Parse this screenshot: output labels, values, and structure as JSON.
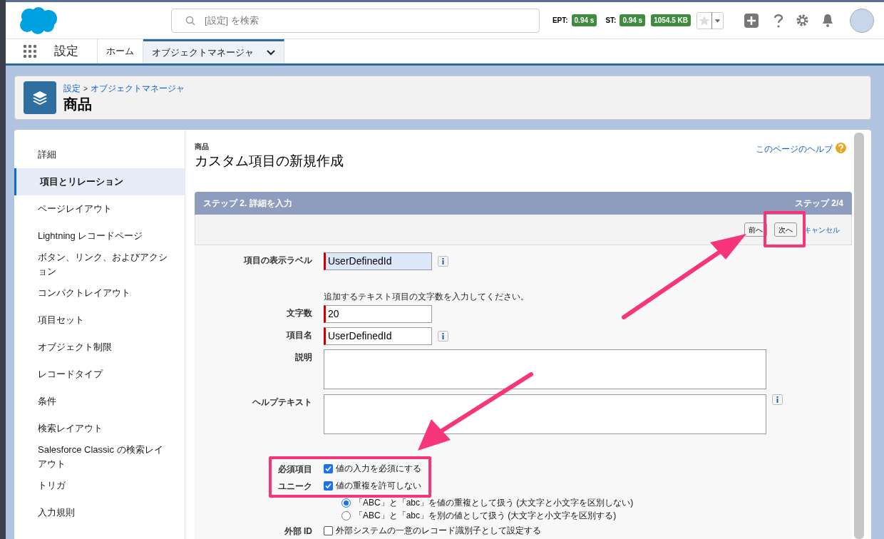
{
  "header": {
    "search": {
      "placeholder": "[設定] を検索"
    },
    "metrics": [
      {
        "label": "EPT:",
        "value": "0.94 s"
      },
      {
        "label": "ST:",
        "value": "0.94 s"
      },
      {
        "value": "1054.5 KB"
      }
    ]
  },
  "nav": {
    "app_name": "設定",
    "tabs": [
      {
        "label": "ホーム",
        "selected": false
      },
      {
        "label": "オブジェクトマネージャ",
        "selected": true
      }
    ]
  },
  "page_header": {
    "breadcrumb": [
      "設定",
      "オブジェクトマネージャ"
    ],
    "breadcrumb_separator": ">",
    "title": "商品"
  },
  "sidebar": {
    "items": [
      {
        "label": "詳細",
        "selected": false
      },
      {
        "label": "項目とリレーション",
        "selected": true
      },
      {
        "label": "ページレイアウト",
        "selected": false
      },
      {
        "label": "Lightning レコードページ",
        "selected": false
      },
      {
        "label": "ボタン、リンク、およびアクション",
        "selected": false
      },
      {
        "label": "コンパクトレイアウト",
        "selected": false
      },
      {
        "label": "項目セット",
        "selected": false
      },
      {
        "label": "オブジェクト制限",
        "selected": false
      },
      {
        "label": "レコードタイプ",
        "selected": false
      },
      {
        "label": "条件",
        "selected": false
      },
      {
        "label": "検索レイアウト",
        "selected": false
      },
      {
        "label": "Salesforce Classic の検索レイアウト",
        "selected": false
      },
      {
        "label": "トリガ",
        "selected": false
      },
      {
        "label": "入力規則",
        "selected": false
      }
    ]
  },
  "content": {
    "object": "商品",
    "title": "カスタム項目の新規作成",
    "help_link": "このページのヘルプ",
    "step": {
      "title": "ステップ 2. 詳細を入力",
      "counter": "ステップ 2/4"
    },
    "buttons": [
      "前へ",
      "次へ"
    ],
    "cancel_link": "キャンセル",
    "fields": [
      {
        "kind": "text",
        "label": "項目の表示ラベル",
        "value": "UserDefinedId",
        "required": true,
        "info": true,
        "focused": true
      },
      {
        "kind": "note",
        "text": "追加するテキスト項目の文字数を入力してください。"
      },
      {
        "kind": "text",
        "label": "文字数",
        "value": "20",
        "required": true,
        "info": false,
        "focused": false
      },
      {
        "kind": "text",
        "label": "項目名",
        "value": "UserDefinedId",
        "required": true,
        "info": true,
        "focused": false
      },
      {
        "kind": "textarea",
        "label": "説明",
        "info": false
      },
      {
        "kind": "textarea",
        "label": "ヘルプテキスト",
        "info": true
      },
      {
        "kind": "checkbox",
        "label": "必須項目",
        "text": "値の入力を必須にする",
        "checked": true
      },
      {
        "kind": "checkbox",
        "label": "ユニーク",
        "text": "値の重複を許可しない",
        "checked": true
      },
      {
        "kind": "radio",
        "text": "「ABC」と「abc」を値の重複として扱う (大文字と小文字を区別しない)",
        "selected": true
      },
      {
        "kind": "radio",
        "text": "「ABC」と「abc」を別の値として扱う (大文字と小文字を区別する)",
        "selected": false
      },
      {
        "kind": "checkbox",
        "label": "外部 ID",
        "text": "外部システムの一意のレコード識別子として設定する",
        "checked": false
      }
    ]
  }
}
